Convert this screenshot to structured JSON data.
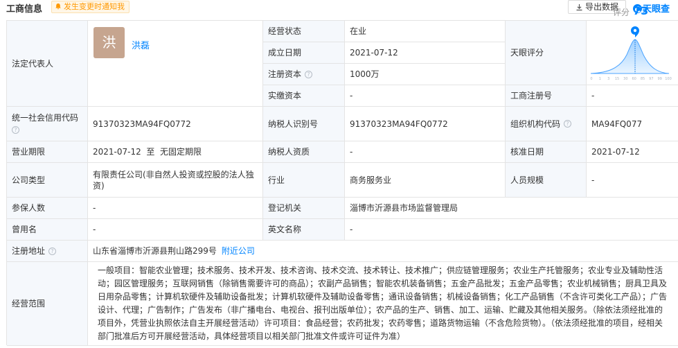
{
  "header": {
    "title": "工商信息",
    "notify_label": "发生变更时通知我",
    "export_label": "导出数据",
    "brand_label": "天眼查"
  },
  "legal_rep": {
    "label": "法定代表人",
    "avatar_char": "洪",
    "name": "洪磊"
  },
  "fields": {
    "status_label": "经营状态",
    "status_value": "在业",
    "found_label": "成立日期",
    "found_value": "2021-07-12",
    "capital_label": "注册资本",
    "capital_value": "1000万",
    "paid_label": "实缴资本",
    "paid_value": "-",
    "tianyan_label": "天眼评分",
    "score_label": "评分",
    "score_value": "73",
    "biz_reg_label": "工商注册号",
    "biz_reg_value": "-",
    "credit_label": "统一社会信用代码",
    "credit_value": "91370323MA94FQ0772",
    "taxpayer_id_label": "纳税人识别号",
    "taxpayer_id_value": "91370323MA94FQ0772",
    "org_code_label": "组织机构代码",
    "org_code_value": "MA94FQ077",
    "term_label": "营业期限",
    "term_value": "2021-07-12  至  无固定期限",
    "taxpayer_q_label": "纳税人资质",
    "taxpayer_q_value": "-",
    "approve_label": "核准日期",
    "approve_value": "2021-07-12",
    "type_label": "公司类型",
    "type_value": "有限责任公司(非自然人投资或控股的法人独资)",
    "industry_label": "行业",
    "industry_value": "商务服务业",
    "staff_label": "人员规模",
    "staff_value": "-",
    "insured_label": "参保人数",
    "insured_value": "-",
    "authority_label": "登记机关",
    "authority_value": "淄博市沂源县市场监督管理局",
    "former_label": "曾用名",
    "former_value": "-",
    "english_label": "英文名称",
    "english_value": "-",
    "address_label": "注册地址",
    "address_value": "山东省淄博市沂源县荆山路299号",
    "nearby_link": "附近公司",
    "scope_label": "经营范围",
    "scope_value": "一般项目：智能农业管理；技术服务、技术开发、技术咨询、技术交流、技术转让、技术推广；供应链管理服务；农业生产托管服务；农业专业及辅助性活动；园区管理服务；互联网销售（除销售需要许可的商品）；农副产品销售；智能农机装备销售；五金产品批发；五金产品零售；农业机械销售；厨具卫具及日用杂品零售；计算机软硬件及辅助设备批发；计算机软硬件及辅助设备零售；通讯设备销售；机械设备销售；化工产品销售（不含许可类化工产品）；广告设计、代理；广告制作；广告发布（非广播电台、电视台、报刊出版单位）；农产品的生产、销售、加工、运输、贮藏及其他相关服务。（除依法须经批准的项目外，凭营业执照依法自主开展经营活动）许可项目：食品经营；农药批发；农药零售；道路货物运输（不含危险货物）。（依法须经批准的项目，经相关部门批准后方可开展经营活动，具体经营项目以相关部门批准文件或许可证件为准）"
  },
  "score_axis": [
    "0",
    "1",
    "3",
    "15",
    "30",
    "60",
    "85",
    "97",
    "99",
    "100"
  ],
  "colors": {
    "accent": "#0084ff",
    "label_bg": "#f5f8fc",
    "border": "#e4e4e4",
    "avatar": "#c6a58f",
    "notify": "#ff9900"
  }
}
